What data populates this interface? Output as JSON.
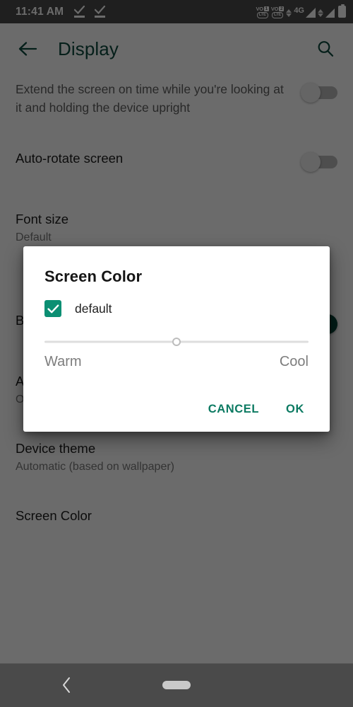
{
  "status_bar": {
    "time": "11:41 AM",
    "left_icons": [
      "download-complete-icon",
      "download-complete-icon"
    ],
    "right_icons": [
      {
        "name": "volte-sim1-icon",
        "vo": "VO",
        "sim": "1",
        "lte": "LTE"
      },
      {
        "name": "volte-sim2-icon",
        "vo": "VO",
        "sim": "2",
        "lte": "LTE"
      },
      {
        "name": "data-transfer-icon"
      },
      {
        "name": "network-type-label",
        "label": "4G"
      },
      {
        "name": "signal-bars-sim1-icon"
      },
      {
        "name": "signal-bars-sim2-icon"
      },
      {
        "name": "battery-icon"
      }
    ]
  },
  "app_bar": {
    "back_icon": "arrow-left-icon",
    "title": "Display",
    "search_icon": "search-icon",
    "accent_color": "#0c4a3e"
  },
  "settings_list": [
    {
      "id": "smart-screen-on",
      "description": "Extend the screen on time while you're looking at it and holding the device upright",
      "control": "switch",
      "state": "off"
    },
    {
      "id": "auto-rotate-screen",
      "title": "Auto-rotate screen",
      "control": "switch",
      "state": "off"
    },
    {
      "id": "font-size",
      "title": "Font size",
      "subtitle": "Default"
    },
    {
      "id": "blink-light",
      "title": "Blink light",
      "control": "switch",
      "state": "on"
    },
    {
      "id": "ambient-display",
      "title": "Ambient display",
      "subtitle": "Off"
    },
    {
      "id": "device-theme",
      "title": "Device theme",
      "subtitle": "Automatic (based on wallpaper)"
    },
    {
      "id": "screen-color",
      "title": "Screen Color"
    }
  ],
  "dialog": {
    "title": "Screen Color",
    "checkbox": {
      "label": "default",
      "checked": true,
      "color": "#0b8f73"
    },
    "slider": {
      "value_percent": 50,
      "left_label": "Warm",
      "right_label": "Cool"
    },
    "cancel_label": "CANCEL",
    "ok_label": "OK",
    "button_color": "#0c7a62"
  },
  "nav_bar": {
    "back_icon": "chevron-left-icon",
    "home_indicator": "home-pill-indicator"
  }
}
